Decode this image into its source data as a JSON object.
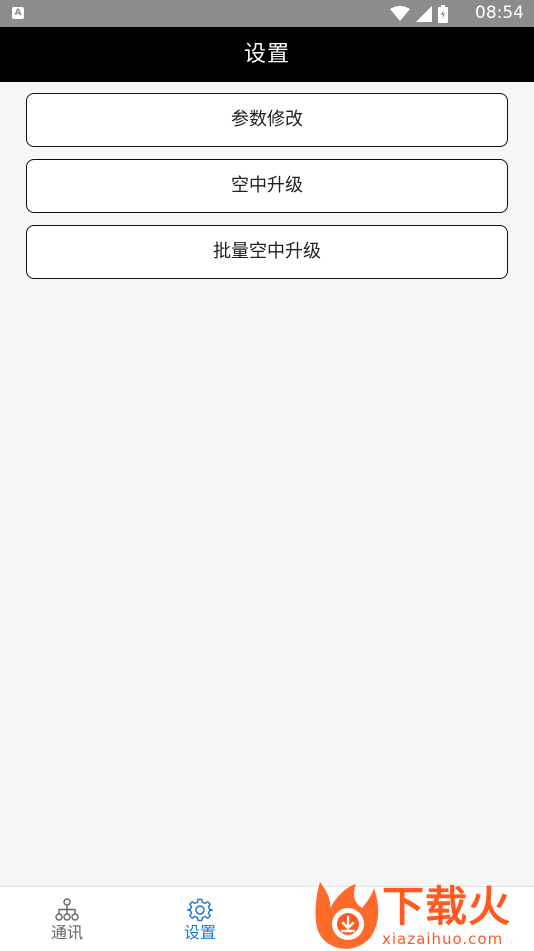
{
  "status_bar": {
    "left_icon_letter": "A",
    "time": "08:54",
    "icons": [
      "wifi-icon",
      "cellular-signal-icon",
      "battery-icon"
    ]
  },
  "app_bar": {
    "title": "设置"
  },
  "settings": {
    "items": [
      {
        "label": "参数修改"
      },
      {
        "label": "空中升级"
      },
      {
        "label": "批量空中升级"
      }
    ]
  },
  "bottom_nav": {
    "items": [
      {
        "label": "通讯",
        "icon": "network-tree-icon",
        "active": false
      },
      {
        "label": "设置",
        "icon": "gear-icon",
        "active": true
      }
    ]
  },
  "watermark": {
    "title": "下载火",
    "url": "xiazaihuo.com"
  },
  "colors": {
    "status_bar_bg": "#8c8c8c",
    "app_bar_bg": "#000000",
    "page_bg": "#f6f6f6",
    "nav_active": "#1e7ad0",
    "nav_inactive": "#666666",
    "watermark": "#ff5a1f"
  }
}
